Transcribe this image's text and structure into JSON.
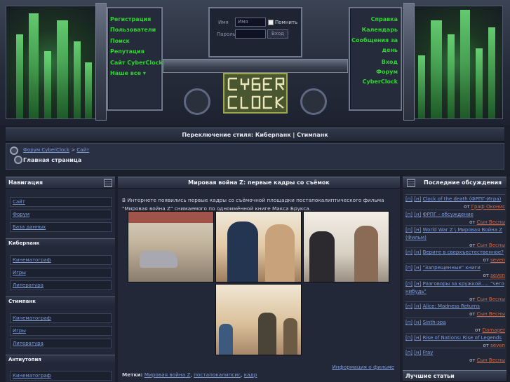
{
  "header": {
    "nav_left": [
      "Регистрация",
      "Пользователи",
      "Поиск",
      "Репутация",
      "Сайт CyberClock",
      "Наше все ▾"
    ],
    "nav_right": [
      "Справка",
      "Календарь",
      "Сообщения за день",
      "Вход",
      "Форум CyberClock"
    ],
    "login": {
      "name_label": "Имя",
      "name_value": "Имя",
      "password_label": "Пароль",
      "remember_label": "Помнить",
      "login_button": "Вход"
    }
  },
  "style_switch": "Переключение стиля: Киберпанк | Стимпанк",
  "breadcrumb": {
    "forum": "Форум CyberClock",
    "sep": ">",
    "site": "Сайт",
    "current": "Главная страница"
  },
  "left": {
    "nav_title": "Навигация",
    "nav_items": [
      "Сайт",
      "Форум",
      "База данных"
    ],
    "cyberpunk_title": "Киберпанк",
    "cyberpunk_items": [
      "Кинематограф",
      "Игры",
      "Литература"
    ],
    "steampunk_title": "Стимпанк",
    "steampunk_items": [
      "Кинематограф",
      "Игры",
      "Литература"
    ],
    "antiutopia_title": "Антиутопия",
    "antiutopia_items": [
      "Кинематограф"
    ]
  },
  "article": {
    "title": "Мировая война Z: первые кадры со съёмок",
    "text": "В Интернете появились первые кадры со съёмочной площадки постапокалиптического фильма \"Мировая война Z\" снимаемого по одноимённой книге Макса Брукса.",
    "info_link": "Информация о фильме",
    "tags_label": "Метки:",
    "tags": [
      "Мировая война Z",
      "постапокалипсис",
      "кадр"
    ]
  },
  "right": {
    "title": "Последние обсуждения",
    "discussions": [
      {
        "topic": "Clock of the death (ФРПГ-Игра)",
        "by": "Граф Оконис"
      },
      {
        "topic": "ФРПГ - обсуждение",
        "by": "Сын Весны"
      },
      {
        "topic": "World War Z \\ Мировая Война Z (Фильм)",
        "by": "Сын Весны"
      },
      {
        "topic": "Верите в сверхъестественное?",
        "by": "seven"
      },
      {
        "topic": "\"Запрещенные\" книги",
        "by": "seven"
      },
      {
        "topic": "Разговоры за кружкой..... \"чего нибудь\"",
        "by": "Сын Весны"
      },
      {
        "topic": "Alice: Madness Returns",
        "by": "Сын Весны"
      },
      {
        "topic": "Sinth-эра",
        "by": "Damager"
      },
      {
        "topic": "Rise of Nations: Rise of Legends",
        "by": "seven"
      },
      {
        "topic": "Fray",
        "by": "Сын Весны"
      }
    ],
    "prefix_a": "[п]",
    "prefix_b": "[н]",
    "by_label": "от",
    "best_title": "Лучшие статьи"
  },
  "colors": {
    "nav_green": "#2fd52f",
    "link_blue": "#7f9bd8",
    "author_orange": "#d8643a"
  }
}
